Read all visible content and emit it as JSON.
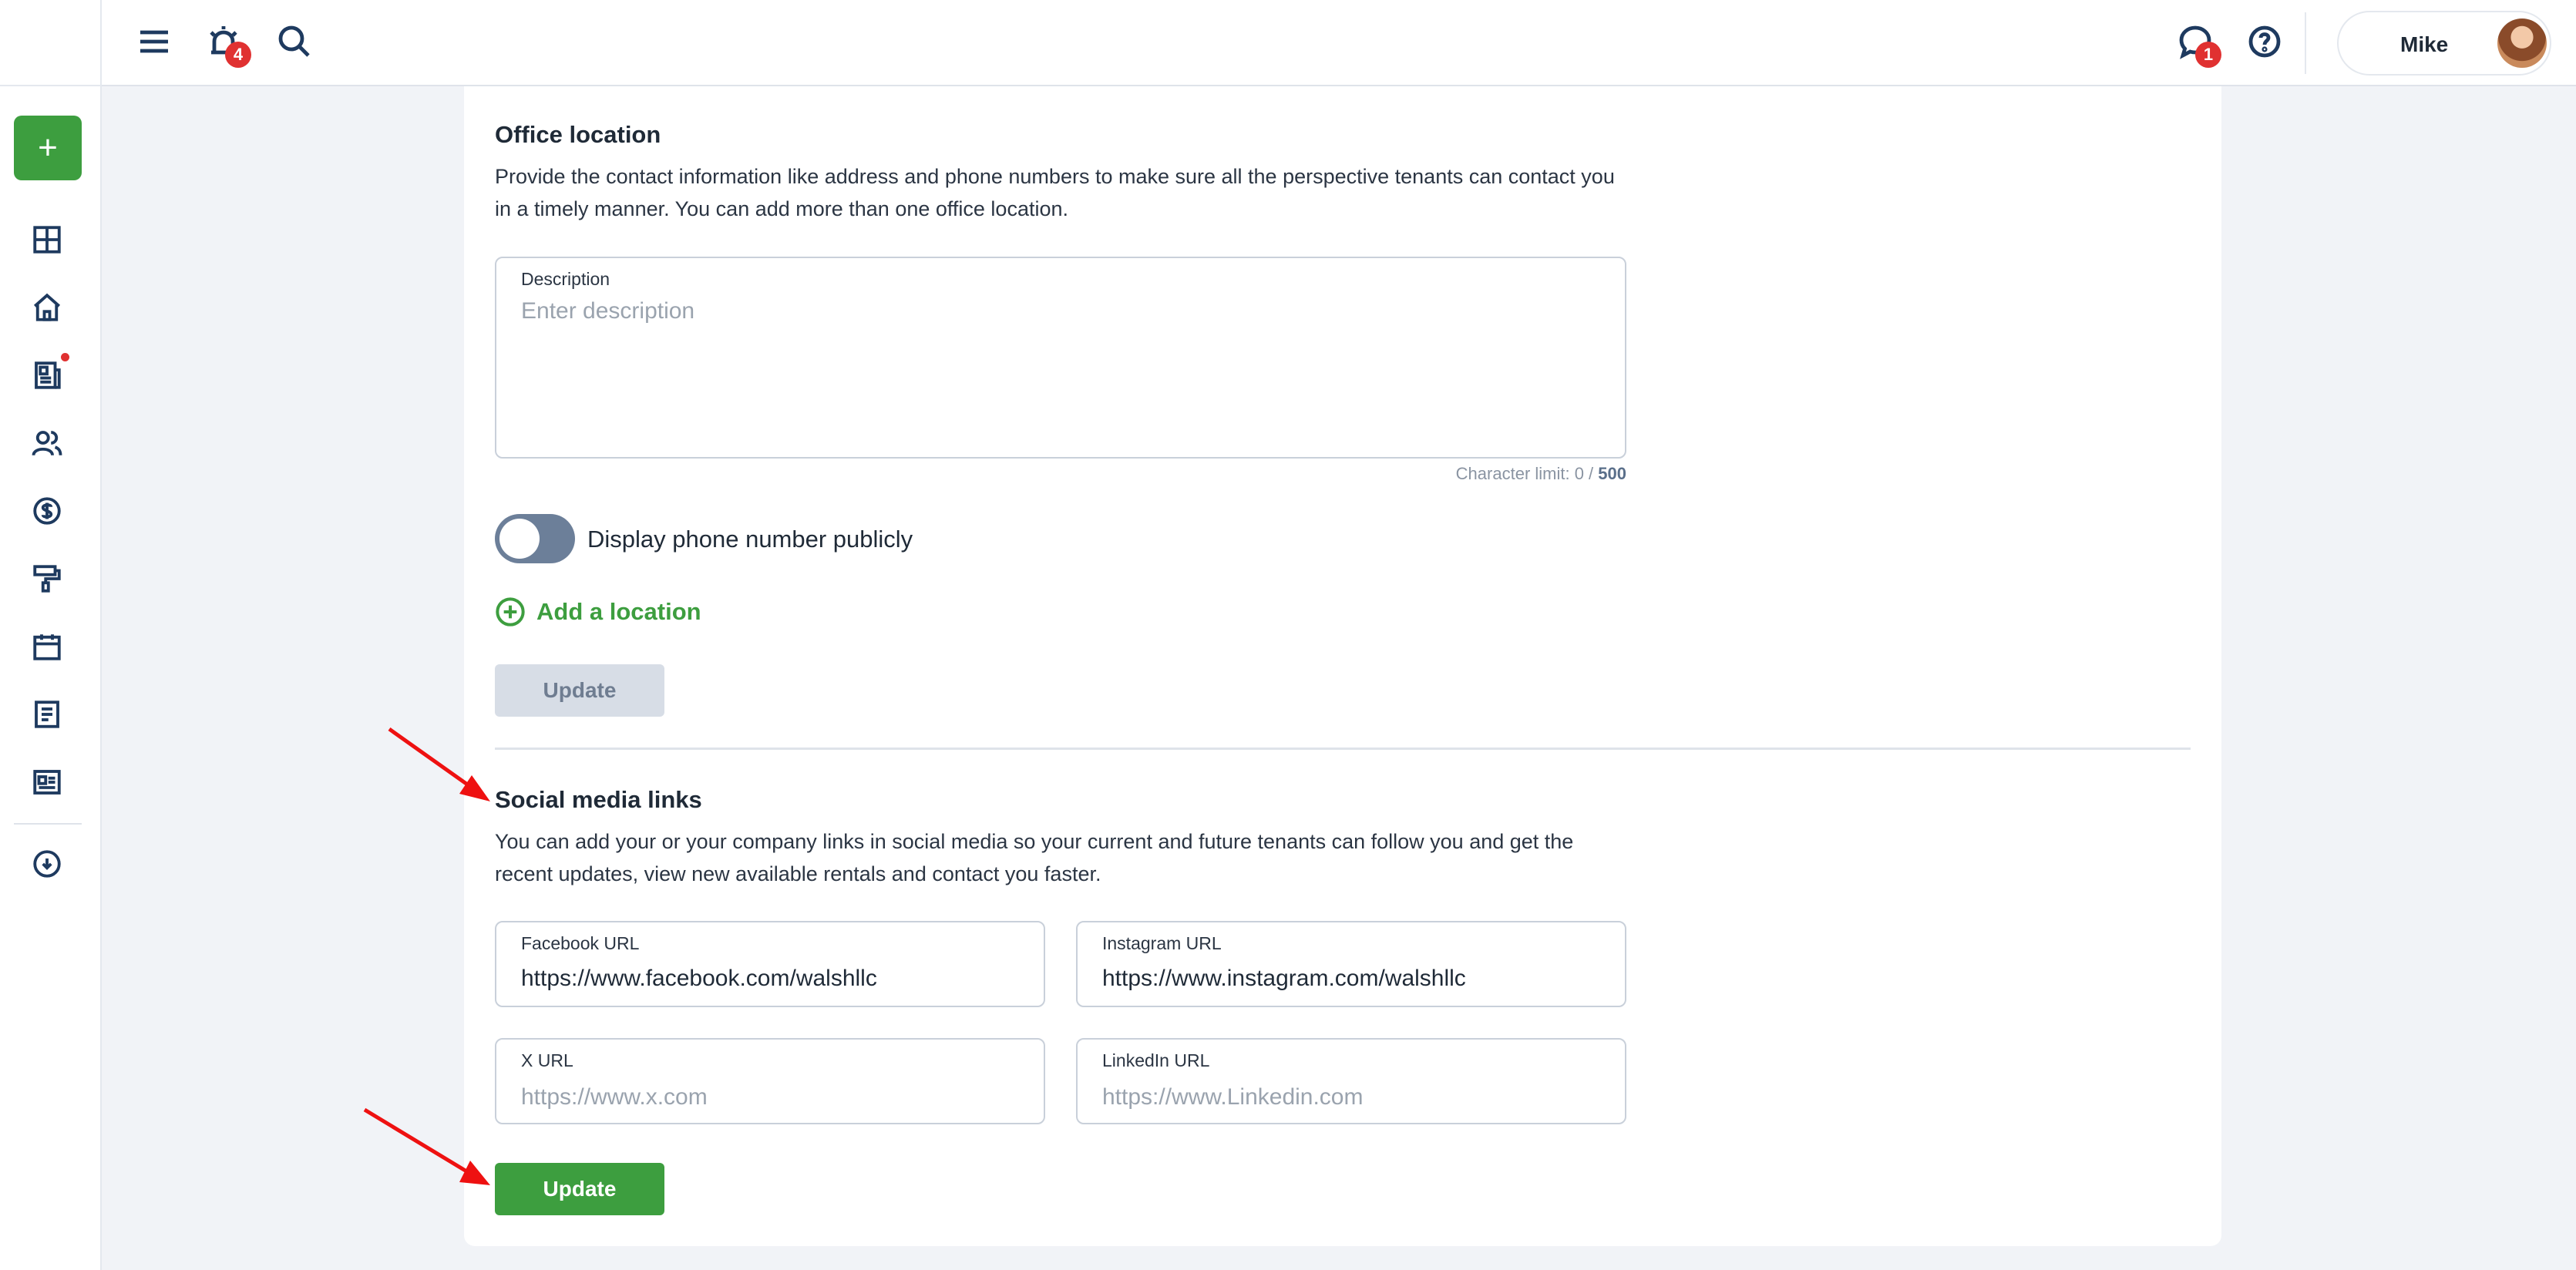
{
  "topbar": {
    "notifications_count": "4",
    "messages_count": "1",
    "user_name": "Mike"
  },
  "sidebar": {
    "add_label": "+",
    "items": [
      {
        "icon": "dashboard-icon"
      },
      {
        "icon": "home-icon"
      },
      {
        "icon": "news-icon",
        "has_dot": true
      },
      {
        "icon": "users-icon"
      },
      {
        "icon": "dollar-icon"
      },
      {
        "icon": "paint-roller-icon"
      },
      {
        "icon": "calendar-icon"
      },
      {
        "icon": "document-icon"
      },
      {
        "icon": "listing-icon"
      },
      {
        "icon": "cloud-download-icon"
      }
    ]
  },
  "office_location": {
    "title": "Office location",
    "description": "Provide the contact information like address and phone numbers to make sure all the perspective tenants can contact you in a timely manner. You can add more than one office location.",
    "description_field": {
      "label": "Description",
      "placeholder": "Enter description"
    },
    "char_limit_prefix": "Character limit: 0 / ",
    "char_limit_max": "500",
    "toggle_label": "Display phone number publicly",
    "add_location_label": "Add a location",
    "update_label": "Update"
  },
  "social_media": {
    "title": "Social media links",
    "description": "You can add your or your company links in social media so your current and future tenants can follow you and get the recent updates, view new available rentals and contact you faster.",
    "facebook": {
      "label": "Facebook URL",
      "value": "https://www.facebook.com/walshllc"
    },
    "instagram": {
      "label": "Instagram URL",
      "value": "https://www.instagram.com/walshllc"
    },
    "x": {
      "label": "X URL",
      "placeholder": "https://www.x.com"
    },
    "linkedin": {
      "label": "LinkedIn URL",
      "placeholder": "https://www.Linkedin.com"
    },
    "update_label": "Update"
  },
  "colors": {
    "accent_green": "#3d9e3f",
    "nav_icon": "#1e3a5f",
    "badge_red": "#e03131",
    "annotation_red": "#ee1111"
  }
}
